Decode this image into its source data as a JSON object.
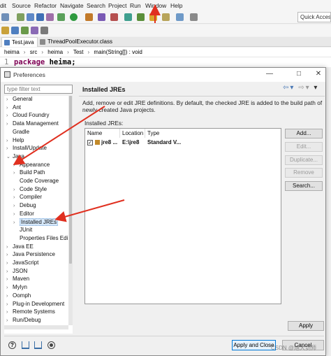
{
  "menubar": {
    "items": [
      "dit",
      "Source",
      "Refactor",
      "Navigate",
      "Search",
      "Project",
      "Run",
      "Window",
      "Help"
    ]
  },
  "toolbar": {
    "quick_access_placeholder": "Quick Access"
  },
  "editor": {
    "tabs": [
      "Test.java",
      "ThreadPoolExecutor.class"
    ],
    "breadcrumb": [
      "heima",
      "src",
      "heima",
      "Test",
      "main(String[]) : void"
    ],
    "line_number": "1",
    "code_keyword": "package",
    "code_rest": " heima;"
  },
  "dialog": {
    "title": "Preferences",
    "filter_placeholder": "type filter text",
    "tree": [
      {
        "label": "General",
        "arrow": ">"
      },
      {
        "label": "Ant",
        "arrow": ">"
      },
      {
        "label": "Cloud Foundry",
        "arrow": ">"
      },
      {
        "label": "Data Management",
        "arrow": ">"
      },
      {
        "label": "Gradle",
        "arrow": ""
      },
      {
        "label": "Help",
        "arrow": ">"
      },
      {
        "label": "Install/Update",
        "arrow": ">"
      },
      {
        "label": "Java",
        "arrow": "v"
      },
      {
        "label": "Appearance",
        "arrow": ">"
      },
      {
        "label": "Build Path",
        "arrow": ">"
      },
      {
        "label": "Code Coverage",
        "arrow": ""
      },
      {
        "label": "Code Style",
        "arrow": ">"
      },
      {
        "label": "Compiler",
        "arrow": ">"
      },
      {
        "label": "Debug",
        "arrow": ">"
      },
      {
        "label": "Editor",
        "arrow": ">"
      },
      {
        "label": "Installed JREs",
        "arrow": ">"
      },
      {
        "label": "JUnit",
        "arrow": ""
      },
      {
        "label": "Properties Files Edi",
        "arrow": ""
      },
      {
        "label": "Java EE",
        "arrow": ">"
      },
      {
        "label": "Java Persistence",
        "arrow": ">"
      },
      {
        "label": "JavaScript",
        "arrow": ">"
      },
      {
        "label": "JSON",
        "arrow": ">"
      },
      {
        "label": "Maven",
        "arrow": ">"
      },
      {
        "label": "Mylyn",
        "arrow": ">"
      },
      {
        "label": "Oomph",
        "arrow": ">"
      },
      {
        "label": "Plug-in Development",
        "arrow": ">"
      },
      {
        "label": "Remote Systems",
        "arrow": ">"
      },
      {
        "label": "Run/Debug",
        "arrow": ">"
      }
    ],
    "page_title": "Installed JREs",
    "description": "Add, remove or edit JRE definitions. By default, the checked JRE is added to the build path of newly created Java projects.",
    "jres_label": "Installed JREs:",
    "table": {
      "headers": [
        "Name",
        "Location",
        "Type"
      ],
      "rows": [
        {
          "checked": true,
          "name": "jre8 ...",
          "location": "E:\\jre8",
          "type": "Standard V..."
        }
      ]
    },
    "buttons": {
      "add": "Add...",
      "edit": "Edit...",
      "duplicate": "Duplicate...",
      "remove": "Remove",
      "search": "Search...",
      "apply": "Apply",
      "apply_close": "Apply and Close",
      "cancel": "Cancel"
    },
    "help_glyph": "?"
  },
  "watermark": "CSDN @旭大剑师",
  "colors": {
    "annotation_arrow": "#e03020",
    "keyword": "#7f0055",
    "selection": "#d6e8fa"
  }
}
